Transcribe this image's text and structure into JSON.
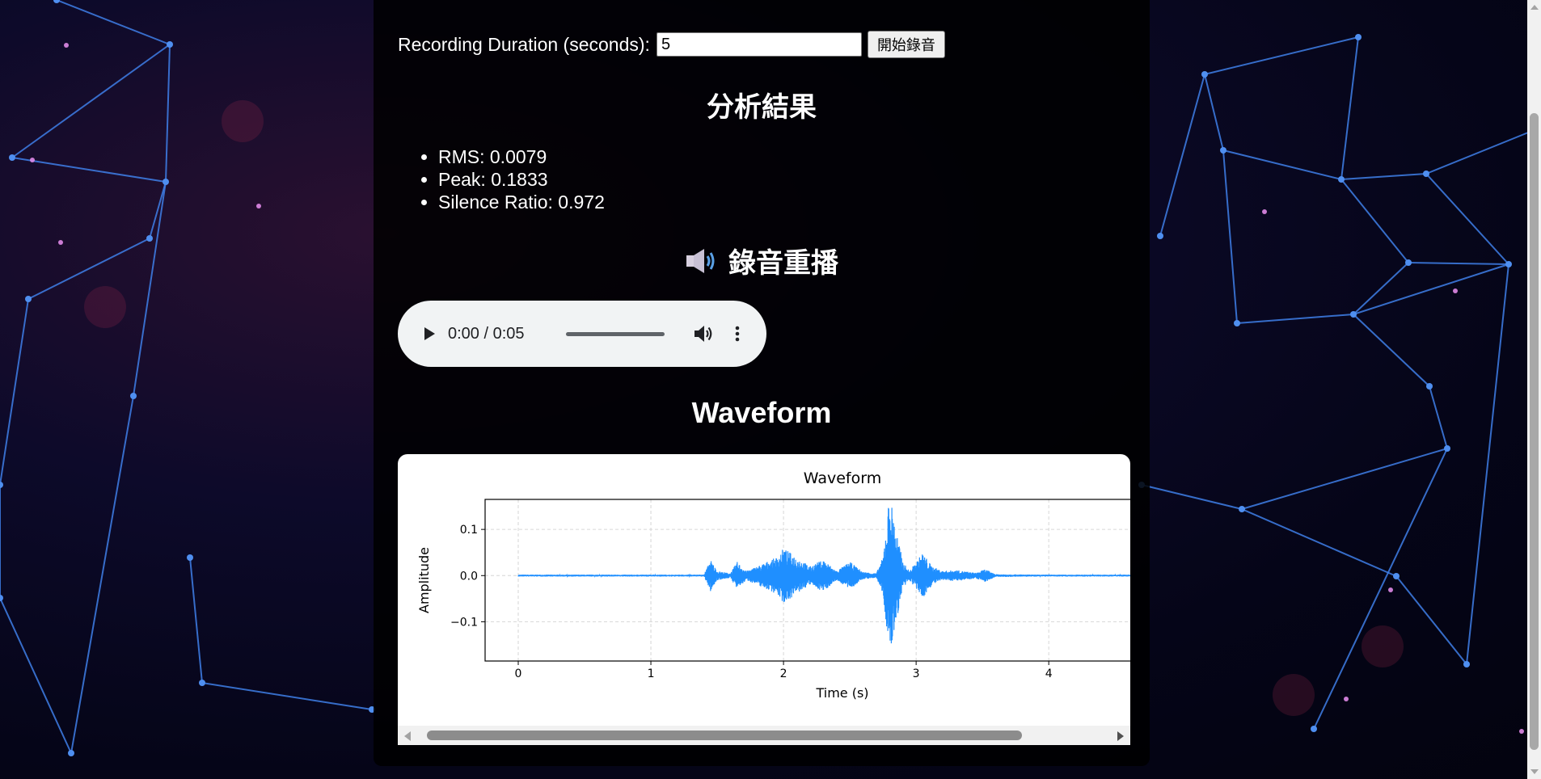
{
  "controls": {
    "duration_label": "Recording Duration (seconds):",
    "duration_value": "5",
    "record_button_label": "開始錄音"
  },
  "analysis": {
    "title": "分析結果",
    "metrics": [
      {
        "label": "RMS",
        "text": "RMS: 0.0079"
      },
      {
        "label": "Peak",
        "text": "Peak: 0.1833"
      },
      {
        "label": "Silence Ratio",
        "text": "Silence Ratio: 0.972"
      }
    ]
  },
  "playback": {
    "title": "錄音重播",
    "icon": "speaker-icon",
    "time_display": "0:00 / 0:05",
    "progress": 0
  },
  "waveform": {
    "heading": "Waveform"
  },
  "colors": {
    "series": "#1f8fff",
    "panel_bg": "rgba(0,0,0,0.86)",
    "player_bg": "#f1f3f4"
  },
  "chart_data": {
    "type": "line",
    "title": "Waveform",
    "xlabel": "Time (s)",
    "ylabel": "Amplitude",
    "xlim": [
      -0.25,
      4.7
    ],
    "ylim": [
      -0.185,
      0.165
    ],
    "xticks": [
      0,
      1,
      2,
      3,
      4
    ],
    "xtick_labels": [
      "0",
      "1",
      "2",
      "3",
      "4"
    ],
    "yticks": [
      0.1,
      0.0,
      -0.1
    ],
    "ytick_labels": [
      "0.1",
      "0.0",
      "−0.1"
    ],
    "grid": true,
    "series": [
      {
        "color": "#1f8fff",
        "envelope": [
          {
            "t": 0.0,
            "a": 0.002
          },
          {
            "t": 1.4,
            "a": 0.002
          },
          {
            "t": 1.45,
            "a": 0.035
          },
          {
            "t": 1.5,
            "a": 0.01
          },
          {
            "t": 1.6,
            "a": 0.005
          },
          {
            "t": 1.65,
            "a": 0.03
          },
          {
            "t": 1.72,
            "a": 0.01
          },
          {
            "t": 1.8,
            "a": 0.02
          },
          {
            "t": 1.95,
            "a": 0.04
          },
          {
            "t": 2.0,
            "a": 0.06
          },
          {
            "t": 2.1,
            "a": 0.04
          },
          {
            "t": 2.2,
            "a": 0.02
          },
          {
            "t": 2.3,
            "a": 0.035
          },
          {
            "t": 2.4,
            "a": 0.01
          },
          {
            "t": 2.5,
            "a": 0.03
          },
          {
            "t": 2.6,
            "a": 0.008
          },
          {
            "t": 2.7,
            "a": 0.005
          },
          {
            "t": 2.75,
            "a": 0.04
          },
          {
            "t": 2.8,
            "a": 0.18
          },
          {
            "t": 2.85,
            "a": 0.1
          },
          {
            "t": 2.9,
            "a": 0.03
          },
          {
            "t": 2.95,
            "a": 0.01
          },
          {
            "t": 3.05,
            "a": 0.05
          },
          {
            "t": 3.12,
            "a": 0.02
          },
          {
            "t": 3.2,
            "a": 0.01
          },
          {
            "t": 3.3,
            "a": 0.012
          },
          {
            "t": 3.45,
            "a": 0.006
          },
          {
            "t": 3.52,
            "a": 0.014
          },
          {
            "t": 3.6,
            "a": 0.003
          },
          {
            "t": 3.9,
            "a": 0.002
          },
          {
            "t": 4.7,
            "a": 0.002
          }
        ]
      }
    ]
  }
}
